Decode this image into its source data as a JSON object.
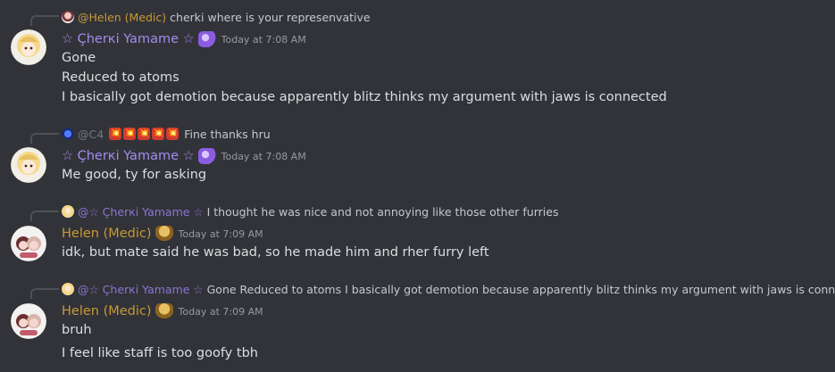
{
  "colors": {
    "background": "#313338",
    "cherki_name": "#a48bf0",
    "helen_name": "#c99836",
    "reply_helen": "#c99836",
    "reply_c4": "#737983",
    "reply_cherki": "#8b74d8"
  },
  "messages": [
    {
      "reply": {
        "name": "@Helen (Medic)",
        "text": "cherki where is your represenvative"
      },
      "author": "☆ Çherкi Yamame ☆",
      "badge_icon": "purple-orb-icon",
      "time": "Today at 7:08 AM",
      "lines": [
        "Gone",
        "Reduced to atoms",
        "I basically got demotion because apparently blitz thinks my argument with jaws is connected"
      ]
    },
    {
      "reply": {
        "name": "@C4",
        "bombs": "💥",
        "text": "Fine thanks hru"
      },
      "author": "☆ Çherкi Yamame ☆",
      "badge_icon": "purple-orb-icon",
      "time": "Today at 7:08 AM",
      "lines": [
        "Me good, ty for asking"
      ]
    },
    {
      "reply": {
        "name": "@☆ Çherкi Yamame ☆",
        "text": "I thought he was nice and not annoying like those other furries"
      },
      "author": "Helen (Medic)",
      "badge_icon": "gold-helmet-icon",
      "time": "Today at 7:09 AM",
      "lines": [
        "idk, but mate said he was bad, so he made him and rher furry left"
      ]
    },
    {
      "reply": {
        "name": "@☆ Çherкi Yamame ☆",
        "text": "Gone Reduced to atoms I basically got demotion because apparently blitz thinks my argument with jaws is connected"
      },
      "author": "Helen (Medic)",
      "badge_icon": "gold-helmet-icon",
      "time": "Today at 7:09 AM",
      "lines": [
        "bruh",
        "I feel like staff is too goofy tbh"
      ]
    }
  ]
}
